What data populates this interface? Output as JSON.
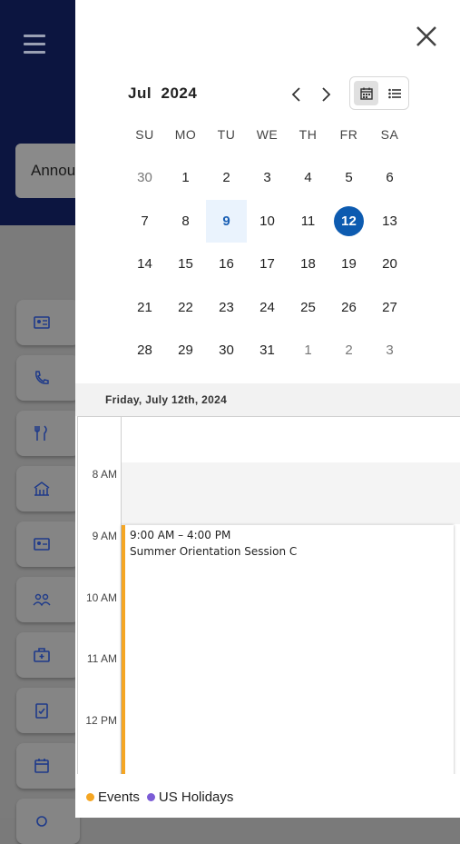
{
  "background": {
    "announcement_label": "Annou"
  },
  "calendar": {
    "month_label": "Jul",
    "year_label": "2024",
    "weekdays": [
      "SU",
      "MO",
      "TU",
      "WE",
      "TH",
      "FR",
      "SA"
    ],
    "weeks": [
      [
        "30",
        "1",
        "2",
        "3",
        "4",
        "5",
        "6"
      ],
      [
        "7",
        "8",
        "9",
        "10",
        "11",
        "12",
        "13"
      ],
      [
        "14",
        "15",
        "16",
        "17",
        "18",
        "19",
        "20"
      ],
      [
        "21",
        "22",
        "23",
        "24",
        "25",
        "26",
        "27"
      ],
      [
        "28",
        "29",
        "30",
        "31",
        "1",
        "2",
        "3"
      ]
    ],
    "today": "9",
    "selected": "12"
  },
  "day_view": {
    "date_label": "Friday, July 12th, 2024",
    "time_labels": [
      "8 AM",
      "9 AM",
      "10 AM",
      "11 AM",
      "12 PM"
    ],
    "event": {
      "time": "9:00 AM – 4:00 PM",
      "title": "Summer Orientation Session C",
      "color": "#f5a623"
    }
  },
  "legend": [
    {
      "label": "Events",
      "color": "#f5a623"
    },
    {
      "label": "US Holidays",
      "color": "#7b5cd6"
    }
  ],
  "colors": {
    "accent": "#0d5bb0",
    "header_bg": "#0c1540"
  }
}
